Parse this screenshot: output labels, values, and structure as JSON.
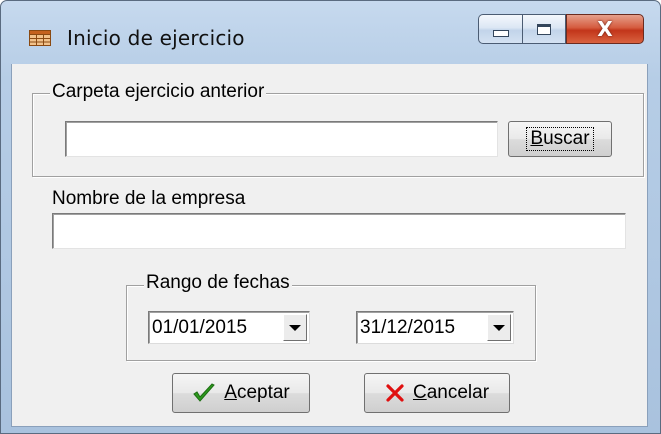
{
  "window": {
    "title": "Inicio de ejercicio",
    "icon": "table-icon",
    "controls": {
      "minimize_icon": "minimize-icon",
      "maximize_icon": "maximize-icon",
      "close_glyph": "X"
    }
  },
  "form": {
    "previous_folder": {
      "group_label": "Carpeta ejercicio anterior",
      "value": "",
      "search_button_label": "Buscar"
    },
    "company": {
      "label": "Nombre de la empresa",
      "value": ""
    },
    "date_range": {
      "group_label": "Rango de fechas",
      "start": "01/01/2015",
      "end": "31/12/2015"
    },
    "buttons": {
      "accept": {
        "label_underlined": "A",
        "label_rest": "ceptar",
        "icon": "checkmark-icon"
      },
      "cancel": {
        "label_underlined": "C",
        "label_rest": "ancelar",
        "icon": "cross-icon"
      }
    }
  },
  "colors": {
    "check_green": "#2e9a1e",
    "cancel_red": "#e01010"
  }
}
